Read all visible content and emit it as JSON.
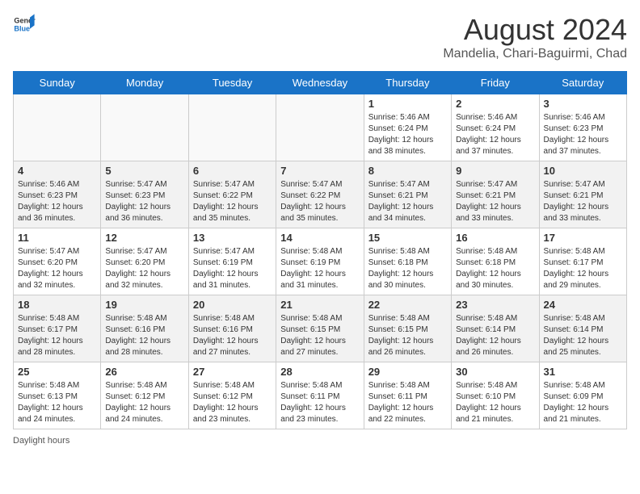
{
  "logo": {
    "general": "General",
    "blue": "Blue"
  },
  "title": "August 2024",
  "subtitle": "Mandelia, Chari-Baguirmi, Chad",
  "days_of_week": [
    "Sunday",
    "Monday",
    "Tuesday",
    "Wednesday",
    "Thursday",
    "Friday",
    "Saturday"
  ],
  "footer": "Daylight hours",
  "weeks": [
    [
      {
        "day": "",
        "info": ""
      },
      {
        "day": "",
        "info": ""
      },
      {
        "day": "",
        "info": ""
      },
      {
        "day": "",
        "info": ""
      },
      {
        "day": "1",
        "info": "Sunrise: 5:46 AM\nSunset: 6:24 PM\nDaylight: 12 hours and 38 minutes."
      },
      {
        "day": "2",
        "info": "Sunrise: 5:46 AM\nSunset: 6:24 PM\nDaylight: 12 hours and 37 minutes."
      },
      {
        "day": "3",
        "info": "Sunrise: 5:46 AM\nSunset: 6:23 PM\nDaylight: 12 hours and 37 minutes."
      }
    ],
    [
      {
        "day": "4",
        "info": "Sunrise: 5:46 AM\nSunset: 6:23 PM\nDaylight: 12 hours and 36 minutes."
      },
      {
        "day": "5",
        "info": "Sunrise: 5:47 AM\nSunset: 6:23 PM\nDaylight: 12 hours and 36 minutes."
      },
      {
        "day": "6",
        "info": "Sunrise: 5:47 AM\nSunset: 6:22 PM\nDaylight: 12 hours and 35 minutes."
      },
      {
        "day": "7",
        "info": "Sunrise: 5:47 AM\nSunset: 6:22 PM\nDaylight: 12 hours and 35 minutes."
      },
      {
        "day": "8",
        "info": "Sunrise: 5:47 AM\nSunset: 6:21 PM\nDaylight: 12 hours and 34 minutes."
      },
      {
        "day": "9",
        "info": "Sunrise: 5:47 AM\nSunset: 6:21 PM\nDaylight: 12 hours and 33 minutes."
      },
      {
        "day": "10",
        "info": "Sunrise: 5:47 AM\nSunset: 6:21 PM\nDaylight: 12 hours and 33 minutes."
      }
    ],
    [
      {
        "day": "11",
        "info": "Sunrise: 5:47 AM\nSunset: 6:20 PM\nDaylight: 12 hours and 32 minutes."
      },
      {
        "day": "12",
        "info": "Sunrise: 5:47 AM\nSunset: 6:20 PM\nDaylight: 12 hours and 32 minutes."
      },
      {
        "day": "13",
        "info": "Sunrise: 5:47 AM\nSunset: 6:19 PM\nDaylight: 12 hours and 31 minutes."
      },
      {
        "day": "14",
        "info": "Sunrise: 5:48 AM\nSunset: 6:19 PM\nDaylight: 12 hours and 31 minutes."
      },
      {
        "day": "15",
        "info": "Sunrise: 5:48 AM\nSunset: 6:18 PM\nDaylight: 12 hours and 30 minutes."
      },
      {
        "day": "16",
        "info": "Sunrise: 5:48 AM\nSunset: 6:18 PM\nDaylight: 12 hours and 30 minutes."
      },
      {
        "day": "17",
        "info": "Sunrise: 5:48 AM\nSunset: 6:17 PM\nDaylight: 12 hours and 29 minutes."
      }
    ],
    [
      {
        "day": "18",
        "info": "Sunrise: 5:48 AM\nSunset: 6:17 PM\nDaylight: 12 hours and 28 minutes."
      },
      {
        "day": "19",
        "info": "Sunrise: 5:48 AM\nSunset: 6:16 PM\nDaylight: 12 hours and 28 minutes."
      },
      {
        "day": "20",
        "info": "Sunrise: 5:48 AM\nSunset: 6:16 PM\nDaylight: 12 hours and 27 minutes."
      },
      {
        "day": "21",
        "info": "Sunrise: 5:48 AM\nSunset: 6:15 PM\nDaylight: 12 hours and 27 minutes."
      },
      {
        "day": "22",
        "info": "Sunrise: 5:48 AM\nSunset: 6:15 PM\nDaylight: 12 hours and 26 minutes."
      },
      {
        "day": "23",
        "info": "Sunrise: 5:48 AM\nSunset: 6:14 PM\nDaylight: 12 hours and 26 minutes."
      },
      {
        "day": "24",
        "info": "Sunrise: 5:48 AM\nSunset: 6:14 PM\nDaylight: 12 hours and 25 minutes."
      }
    ],
    [
      {
        "day": "25",
        "info": "Sunrise: 5:48 AM\nSunset: 6:13 PM\nDaylight: 12 hours and 24 minutes."
      },
      {
        "day": "26",
        "info": "Sunrise: 5:48 AM\nSunset: 6:12 PM\nDaylight: 12 hours and 24 minutes."
      },
      {
        "day": "27",
        "info": "Sunrise: 5:48 AM\nSunset: 6:12 PM\nDaylight: 12 hours and 23 minutes."
      },
      {
        "day": "28",
        "info": "Sunrise: 5:48 AM\nSunset: 6:11 PM\nDaylight: 12 hours and 23 minutes."
      },
      {
        "day": "29",
        "info": "Sunrise: 5:48 AM\nSunset: 6:11 PM\nDaylight: 12 hours and 22 minutes."
      },
      {
        "day": "30",
        "info": "Sunrise: 5:48 AM\nSunset: 6:10 PM\nDaylight: 12 hours and 21 minutes."
      },
      {
        "day": "31",
        "info": "Sunrise: 5:48 AM\nSunset: 6:09 PM\nDaylight: 12 hours and 21 minutes."
      }
    ]
  ]
}
